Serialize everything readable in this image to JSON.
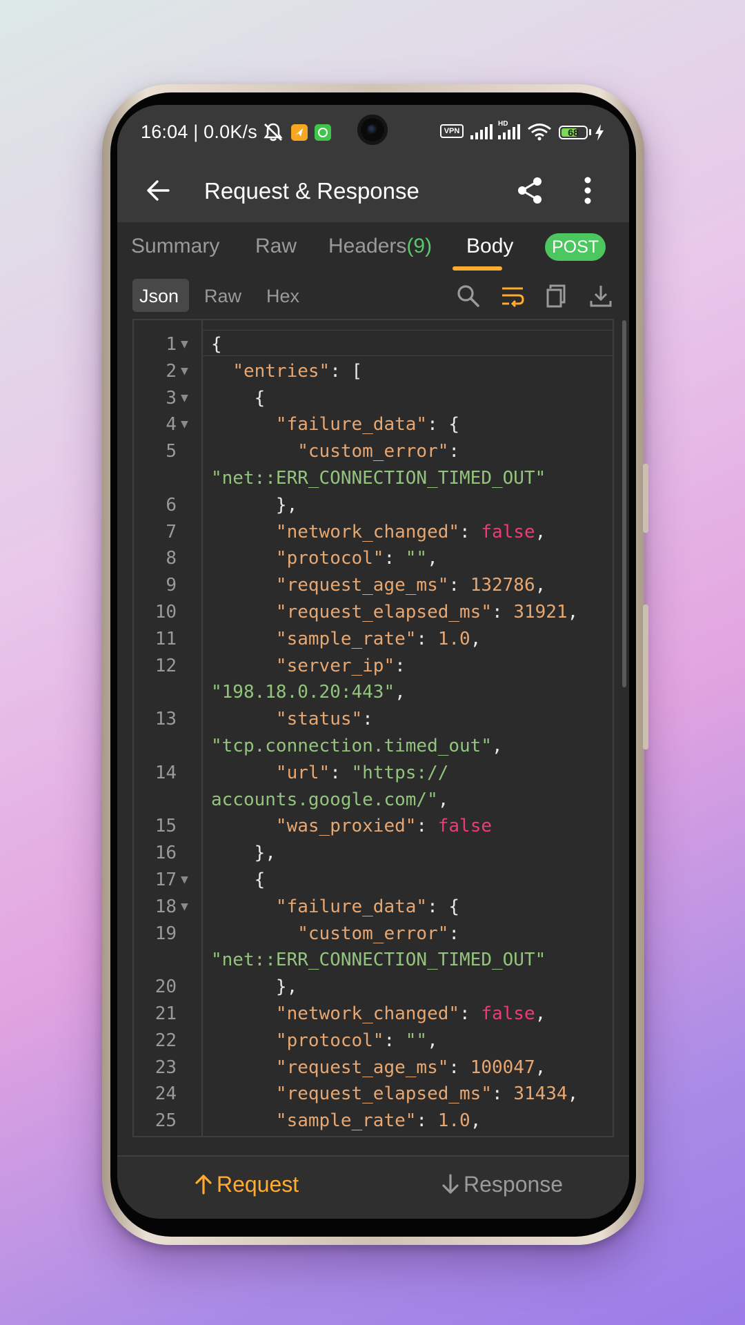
{
  "status_bar": {
    "time_speed": "16:04 | 0.0K/s",
    "vpn_label": "VPN",
    "hd_label": "HD",
    "battery_level": "68",
    "battery_fraction": 0.68,
    "icons": [
      "notifications-muted-icon",
      "orange-app-icon",
      "green-app-icon",
      "vpn-icon",
      "signal-icon",
      "hd-signal-icon",
      "wifi-icon",
      "battery-icon",
      "charging-icon"
    ]
  },
  "app_bar": {
    "title": "Request & Response",
    "icons": [
      "back-arrow-icon",
      "share-icon",
      "more-vert-icon"
    ]
  },
  "tabs": [
    {
      "label": "Summary",
      "count": "",
      "active": false
    },
    {
      "label": "Raw",
      "count": "",
      "active": false
    },
    {
      "label": "Headers",
      "count": "(9)",
      "active": false
    },
    {
      "label": "Body",
      "count": "",
      "active": true
    }
  ],
  "method_badge": "POST",
  "body_view": {
    "formats": [
      {
        "label": "Json",
        "active": true
      },
      {
        "label": "Raw",
        "active": false
      },
      {
        "label": "Hex",
        "active": false
      }
    ],
    "tools": [
      "search-icon",
      "wrap-text-icon",
      "copy-icon",
      "download-icon"
    ]
  },
  "code_lines": [
    {
      "num": "1",
      "fold": true,
      "tokens": [
        {
          "t": "p",
          "v": "{"
        }
      ]
    },
    {
      "num": "2",
      "fold": true,
      "tokens": [
        {
          "t": "p",
          "v": "  "
        },
        {
          "t": "k",
          "v": "\"entries\""
        },
        {
          "t": "p",
          "v": ": ["
        }
      ]
    },
    {
      "num": "3",
      "fold": true,
      "tokens": [
        {
          "t": "p",
          "v": "    {"
        }
      ]
    },
    {
      "num": "4",
      "fold": true,
      "tokens": [
        {
          "t": "p",
          "v": "      "
        },
        {
          "t": "k",
          "v": "\"failure_data\""
        },
        {
          "t": "p",
          "v": ": {"
        }
      ]
    },
    {
      "num": "5",
      "fold": false,
      "tokens": [
        {
          "t": "p",
          "v": "        "
        },
        {
          "t": "k",
          "v": "\"custom_error\""
        },
        {
          "t": "p",
          "v": ":"
        }
      ]
    },
    {
      "num": "",
      "fold": false,
      "tokens": [
        {
          "t": "s",
          "v": "\"net::ERR_CONNECTION_TIMED_OUT\""
        }
      ]
    },
    {
      "num": "6",
      "fold": false,
      "tokens": [
        {
          "t": "p",
          "v": "      },"
        }
      ]
    },
    {
      "num": "7",
      "fold": false,
      "tokens": [
        {
          "t": "p",
          "v": "      "
        },
        {
          "t": "k",
          "v": "\"network_changed\""
        },
        {
          "t": "p",
          "v": ": "
        },
        {
          "t": "b",
          "v": "false"
        },
        {
          "t": "p",
          "v": ","
        }
      ]
    },
    {
      "num": "8",
      "fold": false,
      "tokens": [
        {
          "t": "p",
          "v": "      "
        },
        {
          "t": "k",
          "v": "\"protocol\""
        },
        {
          "t": "p",
          "v": ": "
        },
        {
          "t": "s",
          "v": "\"\""
        },
        {
          "t": "p",
          "v": ","
        }
      ]
    },
    {
      "num": "9",
      "fold": false,
      "tokens": [
        {
          "t": "p",
          "v": "      "
        },
        {
          "t": "k",
          "v": "\"request_age_ms\""
        },
        {
          "t": "p",
          "v": ": "
        },
        {
          "t": "n",
          "v": "132786"
        },
        {
          "t": "p",
          "v": ","
        }
      ]
    },
    {
      "num": "10",
      "fold": false,
      "tokens": [
        {
          "t": "p",
          "v": "      "
        },
        {
          "t": "k",
          "v": "\"request_elapsed_ms\""
        },
        {
          "t": "p",
          "v": ": "
        },
        {
          "t": "n",
          "v": "31921"
        },
        {
          "t": "p",
          "v": ","
        }
      ]
    },
    {
      "num": "11",
      "fold": false,
      "tokens": [
        {
          "t": "p",
          "v": "      "
        },
        {
          "t": "k",
          "v": "\"sample_rate\""
        },
        {
          "t": "p",
          "v": ": "
        },
        {
          "t": "n",
          "v": "1.0"
        },
        {
          "t": "p",
          "v": ","
        }
      ]
    },
    {
      "num": "12",
      "fold": false,
      "tokens": [
        {
          "t": "p",
          "v": "      "
        },
        {
          "t": "k",
          "v": "\"server_ip\""
        },
        {
          "t": "p",
          "v": ":"
        }
      ]
    },
    {
      "num": "",
      "fold": false,
      "tokens": [
        {
          "t": "s",
          "v": "\"198.18.0.20:443\""
        },
        {
          "t": "p",
          "v": ","
        }
      ]
    },
    {
      "num": "13",
      "fold": false,
      "tokens": [
        {
          "t": "p",
          "v": "      "
        },
        {
          "t": "k",
          "v": "\"status\""
        },
        {
          "t": "p",
          "v": ":"
        }
      ]
    },
    {
      "num": "",
      "fold": false,
      "tokens": [
        {
          "t": "s",
          "v": "\"tcp.connection.timed_out\""
        },
        {
          "t": "p",
          "v": ","
        }
      ]
    },
    {
      "num": "14",
      "fold": false,
      "tokens": [
        {
          "t": "p",
          "v": "      "
        },
        {
          "t": "k",
          "v": "\"url\""
        },
        {
          "t": "p",
          "v": ": "
        },
        {
          "t": "s",
          "v": "\"https://"
        }
      ]
    },
    {
      "num": "",
      "fold": false,
      "tokens": [
        {
          "t": "s",
          "v": "accounts.google.com/\""
        },
        {
          "t": "p",
          "v": ","
        }
      ]
    },
    {
      "num": "15",
      "fold": false,
      "tokens": [
        {
          "t": "p",
          "v": "      "
        },
        {
          "t": "k",
          "v": "\"was_proxied\""
        },
        {
          "t": "p",
          "v": ": "
        },
        {
          "t": "b",
          "v": "false"
        }
      ]
    },
    {
      "num": "16",
      "fold": false,
      "tokens": [
        {
          "t": "p",
          "v": "    },"
        }
      ]
    },
    {
      "num": "17",
      "fold": true,
      "tokens": [
        {
          "t": "p",
          "v": "    {"
        }
      ]
    },
    {
      "num": "18",
      "fold": true,
      "tokens": [
        {
          "t": "p",
          "v": "      "
        },
        {
          "t": "k",
          "v": "\"failure_data\""
        },
        {
          "t": "p",
          "v": ": {"
        }
      ]
    },
    {
      "num": "19",
      "fold": false,
      "tokens": [
        {
          "t": "p",
          "v": "        "
        },
        {
          "t": "k",
          "v": "\"custom_error\""
        },
        {
          "t": "p",
          "v": ":"
        }
      ]
    },
    {
      "num": "",
      "fold": false,
      "tokens": [
        {
          "t": "s",
          "v": "\"net::ERR_CONNECTION_TIMED_OUT\""
        }
      ]
    },
    {
      "num": "20",
      "fold": false,
      "tokens": [
        {
          "t": "p",
          "v": "      },"
        }
      ]
    },
    {
      "num": "21",
      "fold": false,
      "tokens": [
        {
          "t": "p",
          "v": "      "
        },
        {
          "t": "k",
          "v": "\"network_changed\""
        },
        {
          "t": "p",
          "v": ": "
        },
        {
          "t": "b",
          "v": "false"
        },
        {
          "t": "p",
          "v": ","
        }
      ]
    },
    {
      "num": "22",
      "fold": false,
      "tokens": [
        {
          "t": "p",
          "v": "      "
        },
        {
          "t": "k",
          "v": "\"protocol\""
        },
        {
          "t": "p",
          "v": ": "
        },
        {
          "t": "s",
          "v": "\"\""
        },
        {
          "t": "p",
          "v": ","
        }
      ]
    },
    {
      "num": "23",
      "fold": false,
      "tokens": [
        {
          "t": "p",
          "v": "      "
        },
        {
          "t": "k",
          "v": "\"request_age_ms\""
        },
        {
          "t": "p",
          "v": ": "
        },
        {
          "t": "n",
          "v": "100047"
        },
        {
          "t": "p",
          "v": ","
        }
      ]
    },
    {
      "num": "24",
      "fold": false,
      "tokens": [
        {
          "t": "p",
          "v": "      "
        },
        {
          "t": "k",
          "v": "\"request_elapsed_ms\""
        },
        {
          "t": "p",
          "v": ": "
        },
        {
          "t": "n",
          "v": "31434"
        },
        {
          "t": "p",
          "v": ","
        }
      ]
    },
    {
      "num": "25",
      "fold": false,
      "tokens": [
        {
          "t": "p",
          "v": "      "
        },
        {
          "t": "k",
          "v": "\"sample_rate\""
        },
        {
          "t": "p",
          "v": ": "
        },
        {
          "t": "n",
          "v": "1.0"
        },
        {
          "t": "p",
          "v": ","
        }
      ]
    }
  ],
  "bottom_nav": {
    "request_label": "Request",
    "response_label": "Response",
    "request_icon": "arrow-up-icon",
    "response_icon": "arrow-down-icon"
  },
  "colors": {
    "accent": "#ffab2e",
    "post_green": "#4cc75f",
    "json_key": "#e7a772",
    "json_string": "#93c47d",
    "json_number": "#e7a772",
    "json_boolean": "#ef3b74"
  }
}
